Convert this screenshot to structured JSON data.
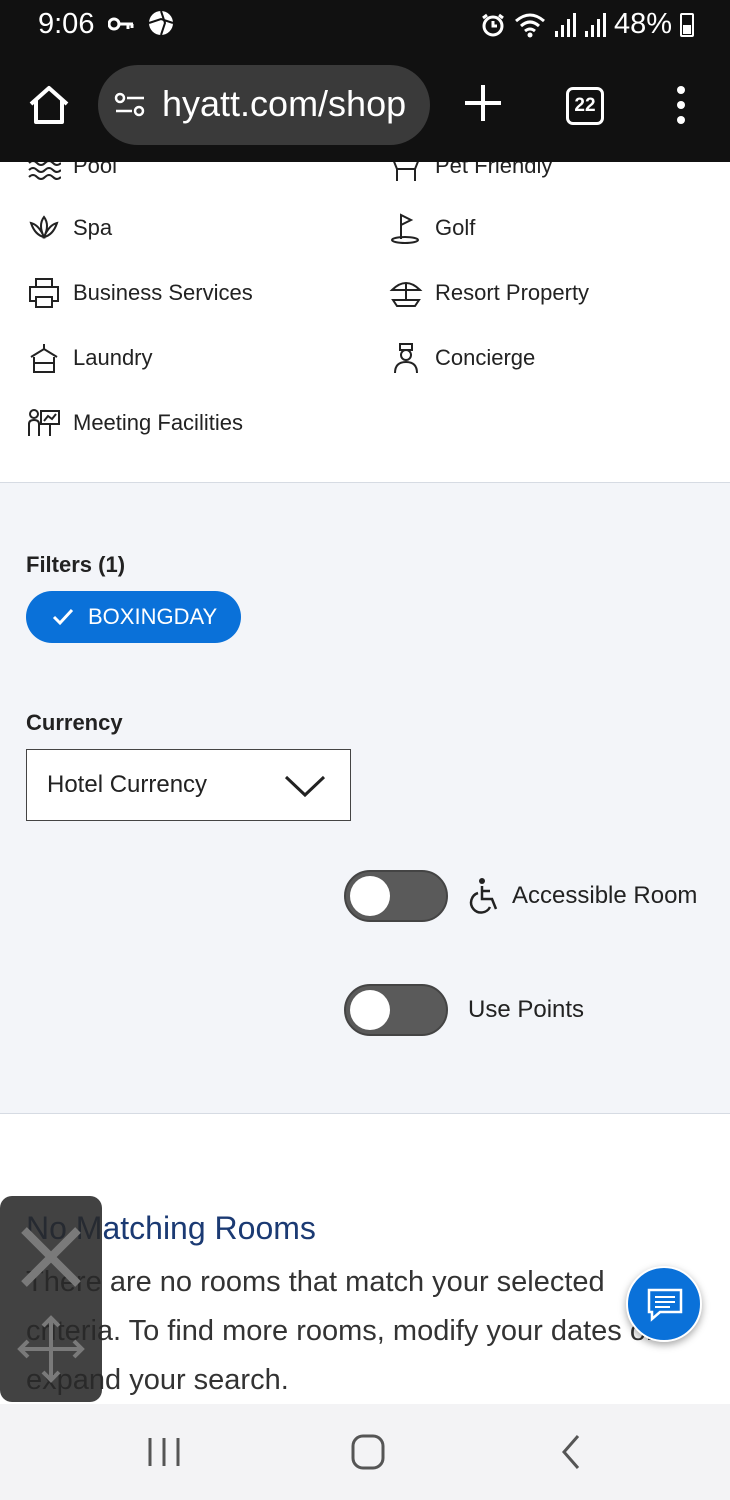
{
  "status_bar": {
    "time": "9:06",
    "battery": "48%",
    "icons": [
      "key-icon",
      "aperture-icon",
      "alarm-icon",
      "wifi-icon",
      "signal-icon",
      "signal-icon",
      "battery-icon"
    ]
  },
  "browser": {
    "url": "hyatt.com/shop",
    "tab_count": "22"
  },
  "amenities": {
    "items": [
      {
        "label": "Pool",
        "icon": "pool-icon"
      },
      {
        "label": "Pet Friendly",
        "icon": "pet-friendly-icon"
      },
      {
        "label": "Spa",
        "icon": "spa-icon"
      },
      {
        "label": "Golf",
        "icon": "golf-icon"
      },
      {
        "label": "Business Services",
        "icon": "business-services-icon"
      },
      {
        "label": "Resort Property",
        "icon": "resort-icon"
      },
      {
        "label": "Laundry",
        "icon": "laundry-icon"
      },
      {
        "label": "Concierge",
        "icon": "concierge-icon"
      },
      {
        "label": "Meeting Facilities",
        "icon": "meeting-facilities-icon"
      }
    ]
  },
  "filters": {
    "heading": "Filters (1)",
    "chip_label": "BOXINGDAY"
  },
  "currency": {
    "label": "Currency",
    "selected": "Hotel Currency"
  },
  "toggles": {
    "accessible_room": "Accessible Room",
    "use_points": "Use Points"
  },
  "results": {
    "title": "No Matching Rooms",
    "message": "There are no rooms that match your selected criteria. To find more rooms, modify your dates or expand your search."
  },
  "colors": {
    "accent": "#0a71d9",
    "title_navy": "#1b3a73",
    "panel_bg": "#f3f5f9"
  }
}
